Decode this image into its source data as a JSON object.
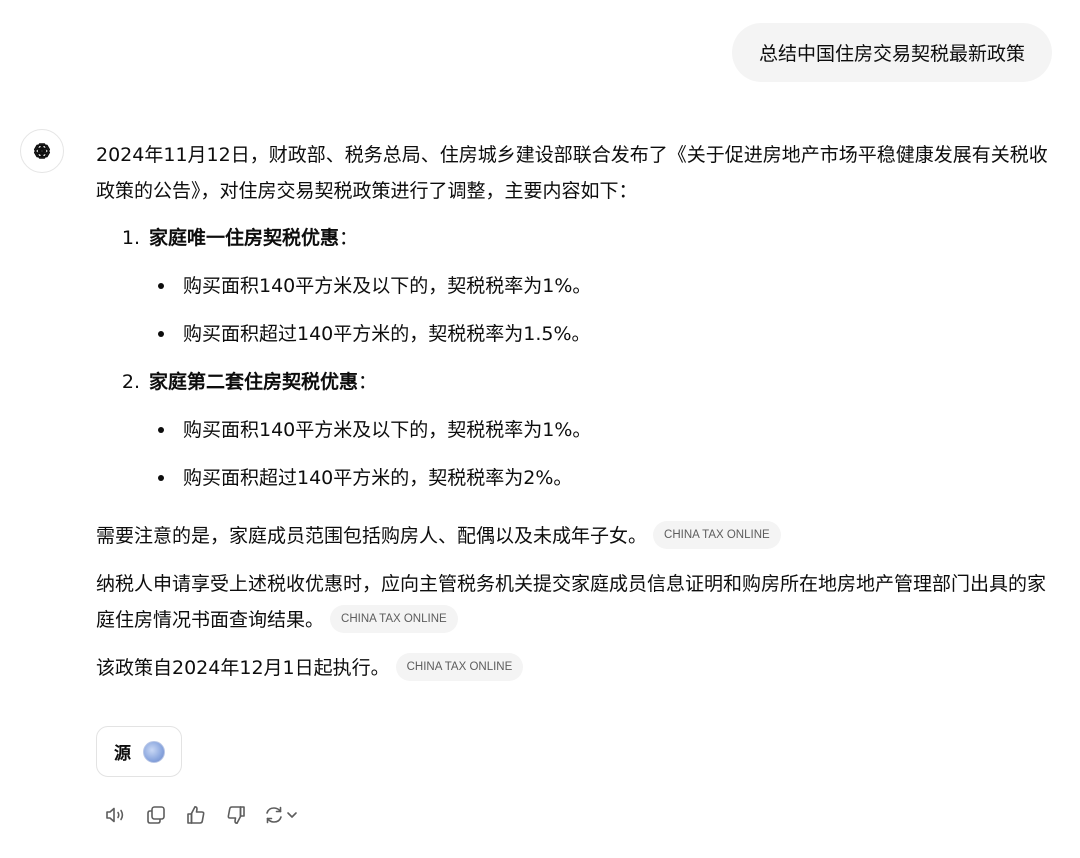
{
  "user_message": "总结中国住房交易契税最新政策",
  "assistant": {
    "intro": "2024年11月12日，财政部、税务总局、住房城乡建设部联合发布了《关于促进房地产市场平稳健康发展有关税收政策的公告》，对住房交易契税政策进行了调整，主要内容如下：",
    "sections": [
      {
        "number": "1.",
        "title": "家庭唯一住房契税优惠",
        "colon": "：",
        "bullets": [
          "购买面积140平方米及以下的，契税税率为1%。",
          "购买面积超过140平方米的，契税税率为1.5%。"
        ]
      },
      {
        "number": "2.",
        "title": "家庭第二套住房契税优惠",
        "colon": "：",
        "bullets": [
          "购买面积140平方米及以下的，契税税率为1%。",
          "购买面积超过140平方米的，契税税率为2%。"
        ]
      }
    ],
    "notes": [
      {
        "text": "需要注意的是，家庭成员范围包括购房人、配偶以及未成年子女。",
        "citation": "CHINA TAX ONLINE"
      },
      {
        "text": "纳税人申请享受上述税收优惠时，应向主管税务机关提交家庭成员信息证明和购房所在地房地产管理部门出具的家庭住房情况书面查询结果。",
        "citation": "CHINA TAX ONLINE"
      },
      {
        "text": "该政策自2024年12月1日起执行。",
        "citation": "CHINA TAX ONLINE"
      }
    ],
    "sources_label": "源"
  },
  "icons": {
    "avatar": "openai-logo-icon",
    "read_aloud": "speaker-icon",
    "copy": "copy-icon",
    "like": "thumbs-up-icon",
    "dislike": "thumbs-down-icon",
    "regenerate": "regenerate-icon",
    "model_menu": "chevron-down-icon"
  },
  "colors": {
    "user_bubble": "#f4f4f4",
    "citation_bg": "#f4f4f4",
    "citation_text": "#5d5d5d",
    "text": "#0d0d0d"
  }
}
